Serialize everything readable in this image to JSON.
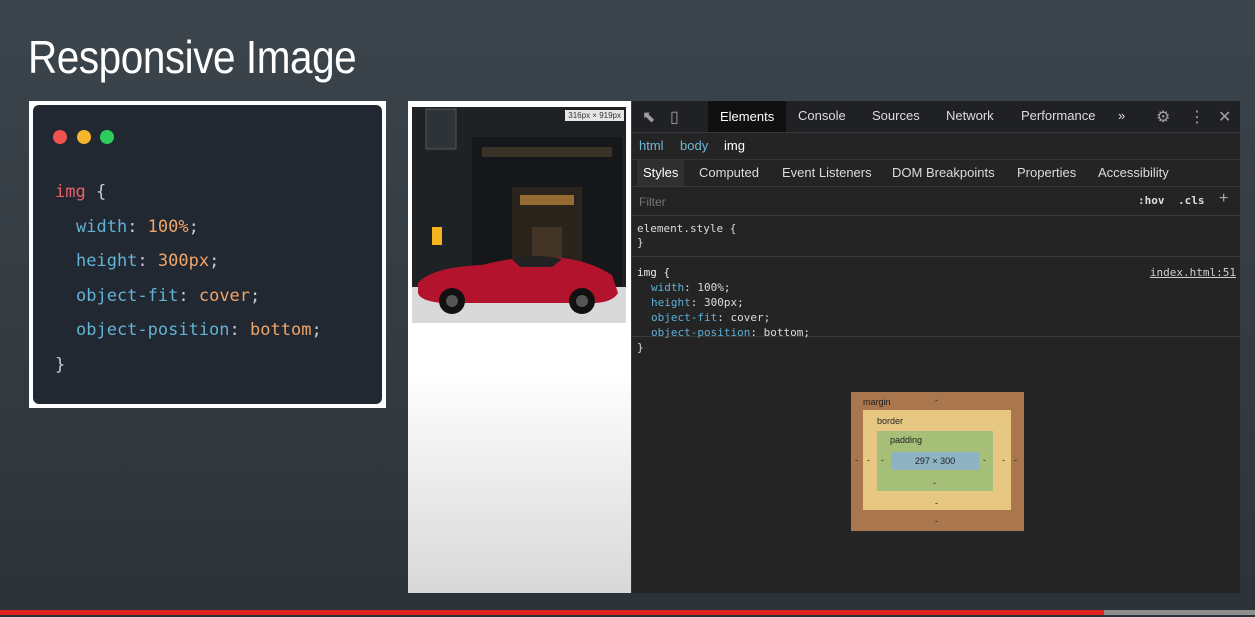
{
  "slide": {
    "title": "Responsive Image"
  },
  "code": {
    "selector": "img",
    "open_brace": "{",
    "close_brace": "}",
    "lines": [
      {
        "prop": "width",
        "value": "100%"
      },
      {
        "prop": "height",
        "value": "300px"
      },
      {
        "prop": "object-fit",
        "value": "cover"
      },
      {
        "prop": "object-position",
        "value": "bottom"
      }
    ]
  },
  "viewport": {
    "size_badge": "316px × 919px"
  },
  "devtools": {
    "tabs": [
      "Elements",
      "Console",
      "Sources",
      "Network",
      "Performance",
      "»"
    ],
    "active_tab": "Elements",
    "breadcrumb": [
      "html",
      "body",
      "img"
    ],
    "subtabs": [
      "Styles",
      "Computed",
      "Event Listeners",
      "DOM Breakpoints",
      "Properties",
      "Accessibility"
    ],
    "active_subtab": "Styles",
    "filter_placeholder": "Filter",
    "hov_label": ":hov",
    "cls_label": ".cls",
    "plus_label": "+",
    "element_style_open": "element.style {",
    "element_style_close": "}",
    "rule_selector": "img {",
    "rule_source": "index.html:51",
    "rule_decls": [
      {
        "prop": "width",
        "value": "100%;"
      },
      {
        "prop": "height",
        "value": "300px;"
      },
      {
        "prop": "object-fit",
        "value": "cover;"
      },
      {
        "prop": "object-position",
        "value": "bottom;"
      }
    ],
    "rule_close": "}",
    "box_model": {
      "margin_label": "margin",
      "border_label": "border",
      "padding_label": "padding",
      "content_size": "297 × 300",
      "dash": "-"
    }
  },
  "video": {
    "progress": 0.88
  },
  "colors": {
    "accent_red": "#e0231e",
    "devtools_bg": "#242424"
  }
}
